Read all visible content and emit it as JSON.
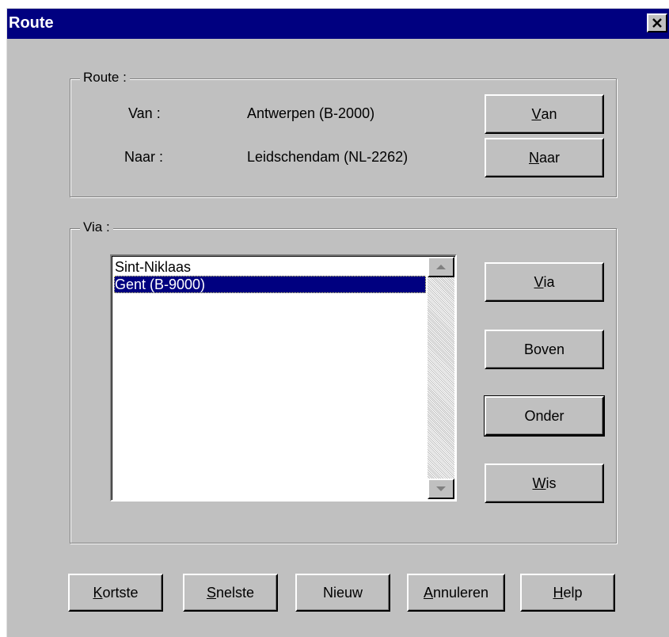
{
  "window": {
    "title": "Route"
  },
  "route_group": {
    "label": "Route :",
    "from_label": "Van :",
    "from_value": "Antwerpen (B-2000)",
    "to_label": "Naar :",
    "to_value": "Leidschendam (NL-2262)",
    "from_button_mnemonic": "V",
    "from_button_rest": "an",
    "to_button_mnemonic": "N",
    "to_button_rest": "aar"
  },
  "via_group": {
    "label": "Via :",
    "items": [
      {
        "label": "Sint-Niklaas",
        "selected": false
      },
      {
        "label": "Gent (B-9000)",
        "selected": true
      }
    ],
    "via_button_mnemonic": "V",
    "via_button_rest": "ia",
    "up_button": "Boven",
    "down_button": "Onder",
    "clear_button_mnemonic": "W",
    "clear_button_rest": "is"
  },
  "footer": {
    "shortest_mnemonic": "K",
    "shortest_rest": "ortste",
    "fastest_mnemonic": "S",
    "fastest_rest": "nelste",
    "new_label": "Nieuw",
    "cancel_mnemonic": "A",
    "cancel_rest": "nnuleren",
    "help_mnemonic": "H",
    "help_rest": "elp"
  },
  "colors": {
    "titlebar": "#000080",
    "face": "#c0c0c0",
    "selection": "#000080"
  }
}
